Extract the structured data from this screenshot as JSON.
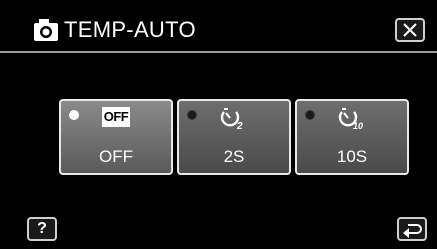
{
  "header": {
    "icon": "camera-icon",
    "title": "TEMP-AUTO",
    "close_icon": "close-icon"
  },
  "options": [
    {
      "badge": "OFF",
      "icon": "",
      "label": "OFF",
      "selected": true
    },
    {
      "badge": "",
      "icon": "self-timer-2s-icon",
      "label": "2S",
      "selected": false
    },
    {
      "badge": "",
      "icon": "self-timer-10s-icon",
      "label": "10S",
      "selected": false
    }
  ],
  "footer": {
    "help_label": "?",
    "back_icon": "return-icon"
  },
  "colors": {
    "background": "#000000",
    "button_border": "#e8e8e8",
    "button_fill": "#5a5a5a",
    "selected_indicator": "#ffffff"
  }
}
